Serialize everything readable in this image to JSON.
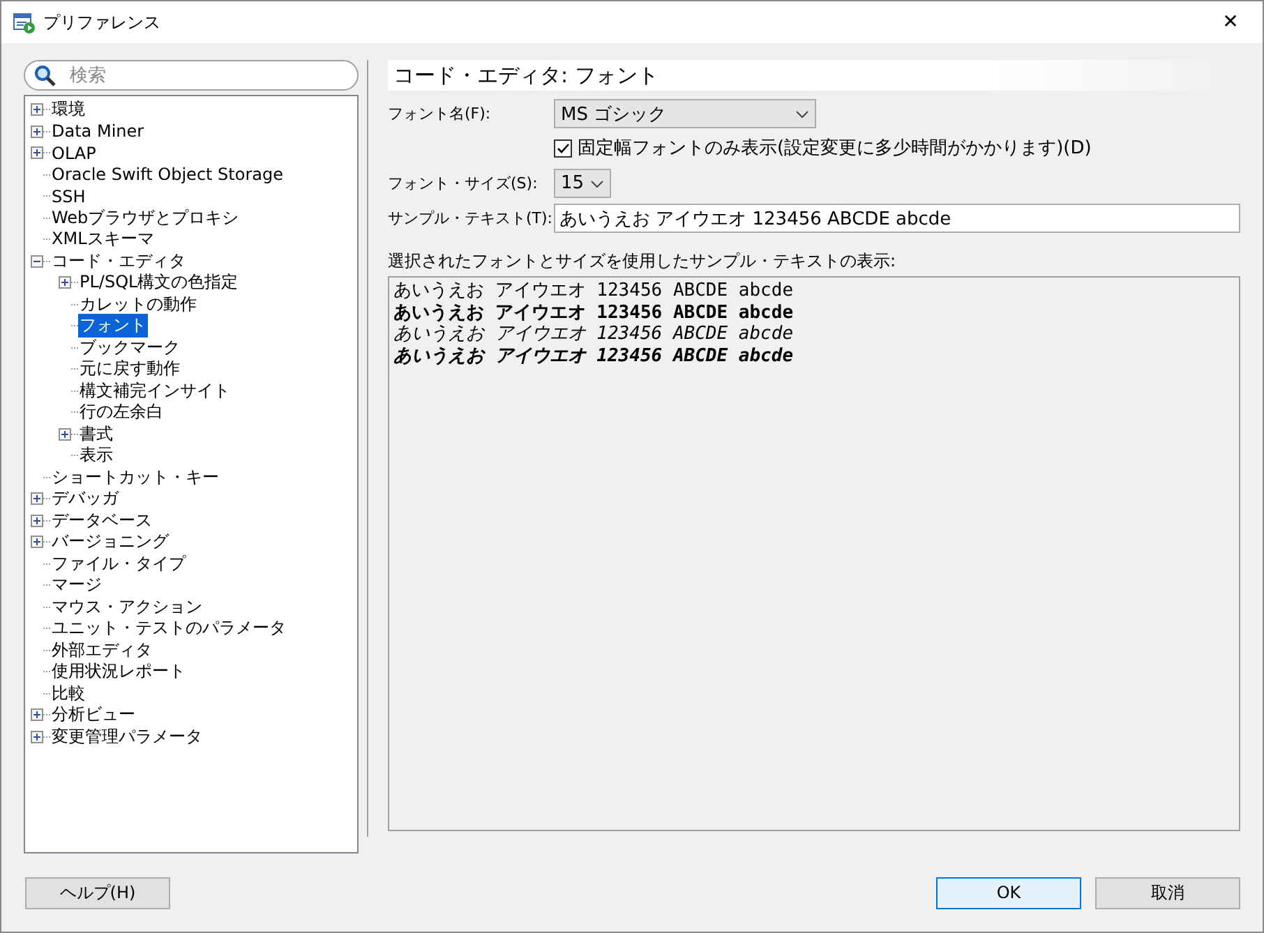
{
  "window": {
    "title": "プリファレンス",
    "close": "✕"
  },
  "search": {
    "placeholder": "検索"
  },
  "tree": [
    {
      "label": "環境",
      "kind": "folder",
      "expanded": false,
      "selected": false
    },
    {
      "label": "Data Miner",
      "kind": "folder",
      "expanded": false,
      "selected": false
    },
    {
      "label": "OLAP",
      "kind": "folder",
      "expanded": false,
      "selected": false
    },
    {
      "label": "Oracle Swift Object Storage",
      "kind": "leaf",
      "selected": false
    },
    {
      "label": "SSH",
      "kind": "leaf",
      "selected": false
    },
    {
      "label": "Webブラウザとプロキシ",
      "kind": "leaf",
      "selected": false
    },
    {
      "label": "XMLスキーマ",
      "kind": "leaf",
      "selected": false
    },
    {
      "label": "コード・エディタ",
      "kind": "folder",
      "expanded": true,
      "selected": false,
      "children": [
        {
          "label": "PL/SQL構文の色指定",
          "kind": "folder",
          "expanded": false,
          "selected": false
        },
        {
          "label": "カレットの動作",
          "kind": "leaf",
          "selected": false
        },
        {
          "label": "フォント",
          "kind": "leaf",
          "selected": true
        },
        {
          "label": "ブックマーク",
          "kind": "leaf",
          "selected": false
        },
        {
          "label": "元に戻す動作",
          "kind": "leaf",
          "selected": false
        },
        {
          "label": "構文補完インサイト",
          "kind": "leaf",
          "selected": false
        },
        {
          "label": "行の左余白",
          "kind": "leaf",
          "selected": false
        },
        {
          "label": "書式",
          "kind": "folder",
          "expanded": false,
          "selected": false
        },
        {
          "label": "表示",
          "kind": "leaf",
          "selected": false
        }
      ]
    },
    {
      "label": "ショートカット・キー",
      "kind": "leaf",
      "selected": false
    },
    {
      "label": "デバッガ",
      "kind": "folder",
      "expanded": false,
      "selected": false
    },
    {
      "label": "データベース",
      "kind": "folder",
      "expanded": false,
      "selected": false
    },
    {
      "label": "バージョニング",
      "kind": "folder",
      "expanded": false,
      "selected": false
    },
    {
      "label": "ファイル・タイプ",
      "kind": "leaf",
      "selected": false
    },
    {
      "label": "マージ",
      "kind": "leaf",
      "selected": false
    },
    {
      "label": "マウス・アクション",
      "kind": "leaf",
      "selected": false
    },
    {
      "label": "ユニット・テストのパラメータ",
      "kind": "leaf",
      "selected": false
    },
    {
      "label": "外部エディタ",
      "kind": "leaf",
      "selected": false
    },
    {
      "label": "使用状況レポート",
      "kind": "leaf",
      "selected": false
    },
    {
      "label": "比較",
      "kind": "leaf",
      "selected": false
    },
    {
      "label": "分析ビュー",
      "kind": "folder",
      "expanded": false,
      "selected": false
    },
    {
      "label": "変更管理パラメータ",
      "kind": "folder",
      "expanded": false,
      "selected": false
    }
  ],
  "heading": "コード・エディタ: フォント",
  "font_name": {
    "label": "フォント名(F):",
    "value": "MS ゴシック"
  },
  "fixed_only": {
    "label": "固定幅フォントのみ表示(設定変更に多少時間がかかります)(D)",
    "checked": true
  },
  "font_size": {
    "label": "フォント・サイズ(S):",
    "value": "15"
  },
  "sample_text": {
    "label": "サンプル・テキスト(T):",
    "value": "あいうえお アイウエオ 123456 ABCDE abcde"
  },
  "preview": {
    "label": "選択されたフォントとサイズを使用したサンプル・テキストの表示:",
    "lines": [
      {
        "text": "あいうえお アイウエオ 123456 ABCDE abcde",
        "kind": "regular"
      },
      {
        "text": "あいうえお アイウエオ 123456 ABCDE abcde",
        "kind": "bold"
      },
      {
        "text": "あいうえお アイウエオ 123456 ABCDE abcde",
        "kind": "italic"
      },
      {
        "text": "あいうえお アイウエオ 123456 ABCDE abcde",
        "kind": "bolditalic"
      }
    ]
  },
  "help_button": {
    "label": "ヘルプ(H)"
  },
  "buttons": [
    {
      "label": "OK",
      "focused": true
    },
    {
      "label": "取消",
      "focused": false
    }
  ]
}
